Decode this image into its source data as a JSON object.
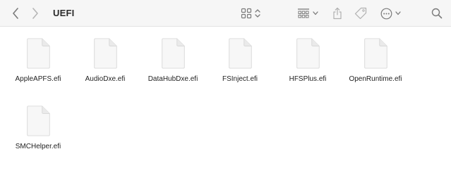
{
  "window": {
    "title": "UEFI"
  },
  "toolbar": {
    "back_icon": "chevron-left-icon",
    "forward_icon": "chevron-right-icon",
    "view_icon": "icon-grid-view-icon",
    "group_icon": "group-by-icon",
    "share_icon": "share-icon",
    "tag_icon": "tag-icon",
    "more_icon": "ellipsis-circle-icon",
    "search_icon": "search-icon"
  },
  "files": [
    {
      "name": "AppleAPFS.efi"
    },
    {
      "name": "AudioDxe.efi"
    },
    {
      "name": "DataHubDxe.efi"
    },
    {
      "name": "FSInject.efi"
    },
    {
      "name": "HFSPlus.efi"
    },
    {
      "name": "OpenRuntime.efi"
    },
    {
      "name": "SMCHelper.efi"
    }
  ],
  "colors": {
    "toolbar_bg": "#f6f6f6",
    "icon": "#8a8a8a",
    "text": "#222222"
  }
}
